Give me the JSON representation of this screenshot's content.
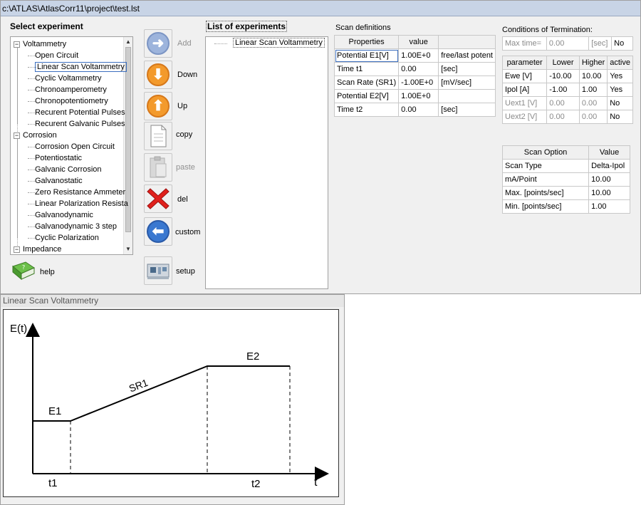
{
  "window": {
    "title": "c:\\ATLAS\\AtlasCorr11\\project\\test.lst"
  },
  "select_experiment": {
    "heading": "Select experiment",
    "groups": [
      {
        "label": "Voltammetry",
        "expander": "−",
        "items": [
          "Open Circuit",
          "Linear Scan Voltammetry",
          "Cyclic Voltammetry",
          "Chronoamperometry",
          "Chronopotentiometry",
          "Recurent Potential Pulses",
          "Recurent Galvanic Pulses"
        ]
      },
      {
        "label": "Corrosion",
        "expander": "−",
        "items": [
          "Corrosion Open Circuit",
          "Potentiostatic",
          "Galvanic Corrosion",
          "Galvanostatic",
          "Zero Resistance Ammeter",
          "Linear Polarization Resista",
          "Galvanodynamic",
          "Galvanodynamic 3 step",
          "Cyclic Polarization"
        ]
      },
      {
        "label": "Impedance",
        "expander": "−",
        "items": []
      }
    ],
    "selected_item": "Linear Scan Voltammetry"
  },
  "toolbar": {
    "add": "Add",
    "down": "Down",
    "up": "Up",
    "copy": "copy",
    "paste": "paste",
    "del": "del",
    "custom": "custom",
    "setup": "setup",
    "help": "help"
  },
  "experiment_list": {
    "heading": "List of experiments",
    "items": [
      "Linear Scan Voltammetry"
    ]
  },
  "scan_definitions": {
    "heading": "Scan definitions",
    "columns": [
      "Properties",
      "value",
      ""
    ],
    "rows": [
      [
        "Potential E1[V]",
        "1.00E+0",
        "free/last potent"
      ],
      [
        "Time t1",
        "0.00",
        "[sec]"
      ],
      [
        "Scan Rate (SR1)",
        "-1.00E+0",
        "[mV/sec]"
      ],
      [
        "Potential E2[V]",
        "1.00E+0",
        ""
      ],
      [
        "Time t2",
        "0.00",
        "[sec]"
      ]
    ]
  },
  "termination": {
    "heading": "Conditions of Termination:",
    "max_time_label": "Max time=",
    "max_time_value": "0.00",
    "max_time_unit": "[sec]",
    "max_time_active": "No",
    "columns": [
      "parameter",
      "Lower",
      "Higher",
      "active"
    ],
    "rows": [
      [
        "Ewe [V]",
        "-10.00",
        "10.00",
        "Yes"
      ],
      [
        "Ipol [A]",
        "-1.00",
        "1.00",
        "Yes"
      ],
      [
        "Uext1 [V]",
        "0.00",
        "0.00",
        "No"
      ],
      [
        "Uext2 [V]",
        "0.00",
        "0.00",
        "No"
      ]
    ]
  },
  "scan_options": {
    "columns": [
      "Scan Option",
      "Value"
    ],
    "rows": [
      [
        "Scan Type",
        "Delta-Ipol"
      ],
      [
        "mA/Point",
        "10.00"
      ],
      [
        "Max. [points/sec]",
        "10.00"
      ],
      [
        "Min. [points/sec]",
        "1.00"
      ]
    ]
  },
  "diagram": {
    "title": "Linear Scan Voltammetry",
    "y_axis_label": "E(t)",
    "x_axis_label": "t",
    "labels": {
      "e1": "E1",
      "e2": "E2",
      "sr1": "SR1",
      "t1": "t1",
      "t2": "t2"
    }
  }
}
